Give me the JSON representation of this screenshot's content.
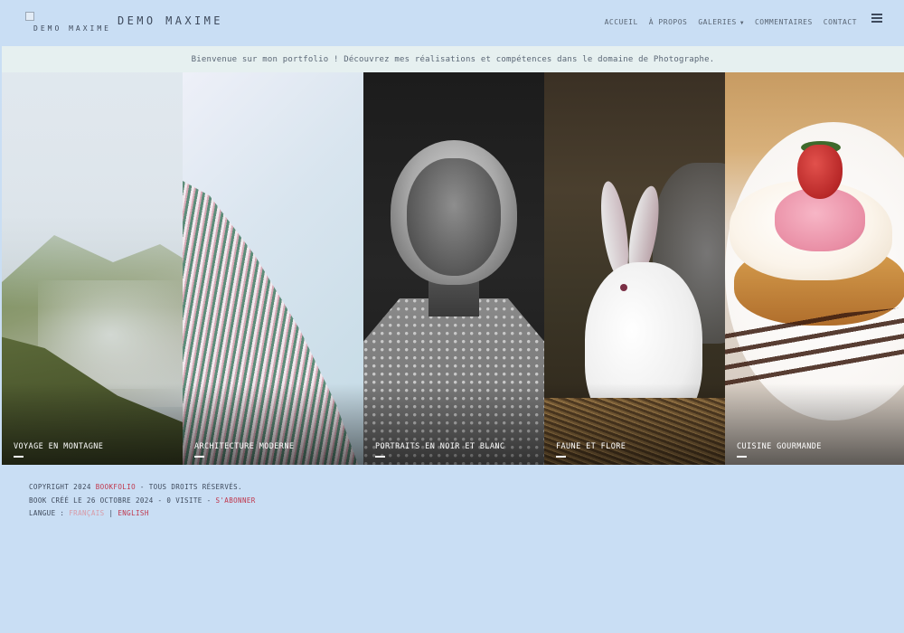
{
  "header": {
    "logo_alt": "DEMO MAXIME",
    "site_name": "DEMO MAXIME",
    "nav": [
      "ACCUEIL",
      "À PROPOS",
      "GALERIES",
      "COMMENTAIRES",
      "CONTACT"
    ],
    "menu_icon": "hamburger-menu-icon"
  },
  "welcome": {
    "text": "Bienvenue sur mon portfolio ! Découvrez mes réalisations et compétences dans le domaine de Photographe."
  },
  "gallery": {
    "tiles": [
      {
        "label": "VOYAGE EN MONTAGNE"
      },
      {
        "label": "ARCHITECTURE MODERNE"
      },
      {
        "label": "PORTRAITS EN NOIR ET BLANC"
      },
      {
        "label": "FAUNE ET FLORE"
      },
      {
        "label": "CUISINE GOURMANDE"
      }
    ]
  },
  "footer": {
    "copyright_prefix": "COPYRIGHT 2024",
    "brand": "BOOKFOLIO",
    "rights": "- TOUS DROITS RÉSERVÉS.",
    "created": "BOOK CRÉÉ LE 26 OCTOBRE 2024 - 0 VISITE -",
    "subscribe": "S'ABONNER",
    "language_label": "LANGUE :",
    "lang_fr": "FRANÇAIS",
    "separator": "|",
    "lang_en": "ENGLISH"
  },
  "colors": {
    "background": "#c9def4",
    "welcome_band": "#e6f0f0",
    "link_accent": "#c0354b",
    "link_pale": "#d89aa6",
    "text": "#3e4a5c"
  }
}
